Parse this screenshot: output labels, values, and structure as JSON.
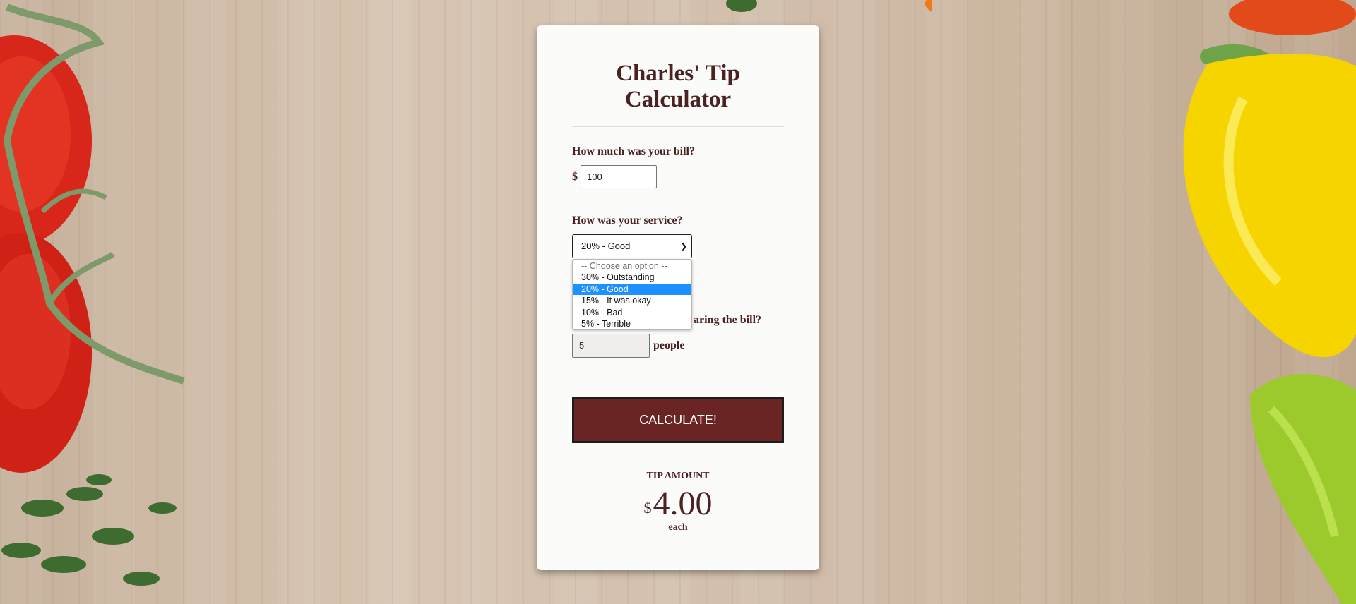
{
  "app": {
    "title": "Charles' Tip Calculator"
  },
  "bill": {
    "question": "How much was your bill?",
    "currency": "$",
    "value": "100"
  },
  "service": {
    "question": "How was your service?",
    "selected": "20% - Good",
    "options": [
      {
        "label": "-- Choose an option --",
        "disabled": true
      },
      {
        "label": "30% - Outstanding"
      },
      {
        "label": "20% - Good",
        "selected": true
      },
      {
        "label": "15% - It was okay"
      },
      {
        "label": "10% - Bad"
      },
      {
        "label": "5% - Terrible"
      }
    ]
  },
  "people": {
    "question_visible_fragment": "aring the bill?",
    "value": "5",
    "unit": "people"
  },
  "calculate_button": "CALCULATE!",
  "result": {
    "label": "TIP AMOUNT",
    "currency": "$",
    "amount": "4.00",
    "suffix": "each"
  },
  "colors": {
    "accent": "#6b2424",
    "text": "#4a2222",
    "selected_option": "#1e90ff"
  }
}
